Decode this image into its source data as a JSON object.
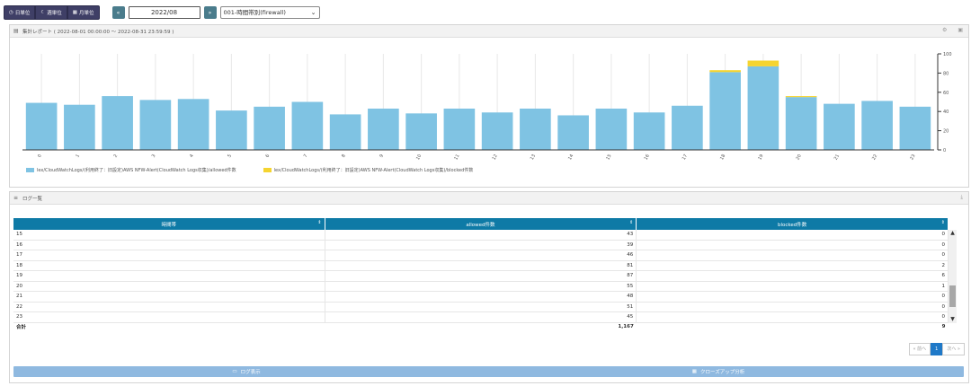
{
  "toolbar": {
    "daily_label": "日単位",
    "weekly_label": "週単位",
    "monthly_label": "月単位",
    "prev_label": "«",
    "month_value": "2022/08",
    "next_label": "»",
    "report_select_value": "001-時間帯別(firewall)"
  },
  "chart_panel": {
    "title": "集計レポート ( 2022-08-01 00:00:00 ～ 2022-08-31 23:59:59 )",
    "icons": [
      "settings-icon",
      "export-icon"
    ]
  },
  "chart_data": {
    "type": "bar",
    "stacked": true,
    "categories": [
      "0",
      "1",
      "2",
      "3",
      "4",
      "5",
      "6",
      "7",
      "8",
      "9",
      "10",
      "11",
      "12",
      "13",
      "14",
      "15",
      "16",
      "17",
      "18",
      "19",
      "20",
      "21",
      "22",
      "23"
    ],
    "series": [
      {
        "name": "lex/CloudWatchLogs/(利用終了：旧設定)AWS NFW-Alert(CloudWatch Logs収集)/allowed件数",
        "color": "#7fc3e3",
        "values": [
          49,
          47,
          56,
          52,
          53,
          41,
          45,
          50,
          37,
          43,
          38,
          43,
          39,
          43,
          36,
          43,
          39,
          46,
          81,
          87,
          55,
          48,
          51,
          45
        ]
      },
      {
        "name": "lex/CloudWatchLogs/(利用終了：旧設定)AWS NFW-Alert(CloudWatch Logs収集)/blocked件数",
        "color": "#f5d430",
        "values": [
          0,
          0,
          0,
          0,
          0,
          0,
          0,
          0,
          0,
          0,
          0,
          0,
          0,
          0,
          0,
          0,
          0,
          0,
          2,
          6,
          1,
          0,
          0,
          0
        ]
      }
    ],
    "ylim": [
      0,
      100
    ],
    "yticks": [
      0,
      20,
      40,
      60,
      80,
      100
    ],
    "axis_side": "right",
    "grid": true,
    "legend_position": "bottom-left"
  },
  "log_panel": {
    "title": "ログ一覧",
    "columns": [
      "時間帯",
      "allowed件数",
      "blocked件数"
    ],
    "rows": [
      [
        "15",
        "43",
        "0"
      ],
      [
        "16",
        "39",
        "0"
      ],
      [
        "17",
        "46",
        "0"
      ],
      [
        "18",
        "81",
        "2"
      ],
      [
        "19",
        "87",
        "6"
      ],
      [
        "20",
        "55",
        "1"
      ],
      [
        "21",
        "48",
        "0"
      ],
      [
        "22",
        "51",
        "0"
      ],
      [
        "23",
        "45",
        "0"
      ]
    ],
    "total": [
      "合計",
      "1,167",
      "9"
    ],
    "pager": {
      "prev": "« 前へ",
      "page": "1",
      "next": "次へ »"
    },
    "log_button": "ログ表示",
    "closeup_button": "クローズアップ分析"
  }
}
